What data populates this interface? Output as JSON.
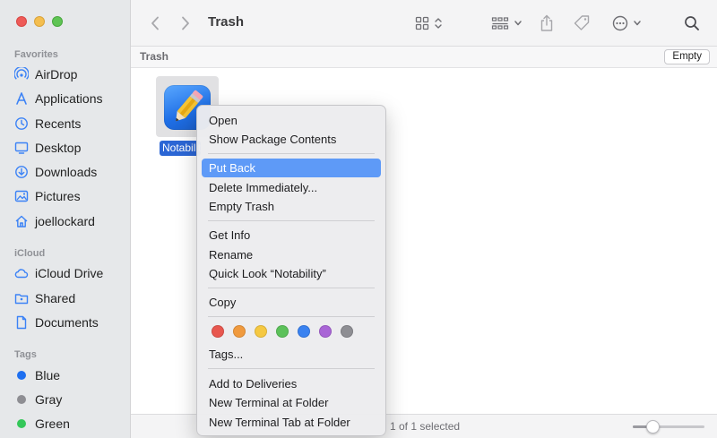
{
  "window": {
    "title": "Trash"
  },
  "toolbar": {
    "title": "Trash",
    "back_icon": "chevron-left-icon",
    "forward_icon": "chevron-right-icon"
  },
  "pathbar": {
    "title": "Trash",
    "empty_label": "Empty"
  },
  "sidebar": {
    "favorites_heading": "Favorites",
    "favorites": [
      {
        "label": "AirDrop",
        "icon": "airdrop-icon"
      },
      {
        "label": "Applications",
        "icon": "applications-icon"
      },
      {
        "label": "Recents",
        "icon": "recents-icon"
      },
      {
        "label": "Desktop",
        "icon": "desktop-icon"
      },
      {
        "label": "Downloads",
        "icon": "downloads-icon"
      },
      {
        "label": "Pictures",
        "icon": "pictures-icon"
      },
      {
        "label": "joellockard",
        "icon": "home-icon"
      }
    ],
    "icloud_heading": "iCloud",
    "icloud": [
      {
        "label": "iCloud Drive",
        "icon": "cloud-icon"
      },
      {
        "label": "Shared",
        "icon": "shared-folder-icon"
      },
      {
        "label": "Documents",
        "icon": "document-icon"
      }
    ],
    "tags_heading": "Tags",
    "tags": [
      {
        "label": "Blue",
        "color": "#1e6ff0"
      },
      {
        "label": "Gray",
        "color": "#8e8e93"
      },
      {
        "label": "Green",
        "color": "#34c759"
      }
    ]
  },
  "file": {
    "name": "Notability"
  },
  "status": {
    "text": "1 of 1 selected",
    "zoom_fraction": 0.27
  },
  "context_menu": {
    "items": [
      "Open",
      "Show Package Contents",
      "Put Back",
      "Delete Immediately...",
      "Empty Trash",
      "Get Info",
      "Rename",
      "Quick Look “Notability”",
      "Copy",
      "Tags...",
      "Add to Deliveries",
      "New Terminal at Folder",
      "New Terminal Tab at Folder"
    ],
    "tag_colors": [
      "#e8574f",
      "#f09a3e",
      "#f5c842",
      "#5cc15a",
      "#3a82f0",
      "#a965d6",
      "#8e8e93"
    ]
  },
  "colors": {
    "accent": "#2b66d5",
    "menu_highlight": "#5e9af7"
  }
}
